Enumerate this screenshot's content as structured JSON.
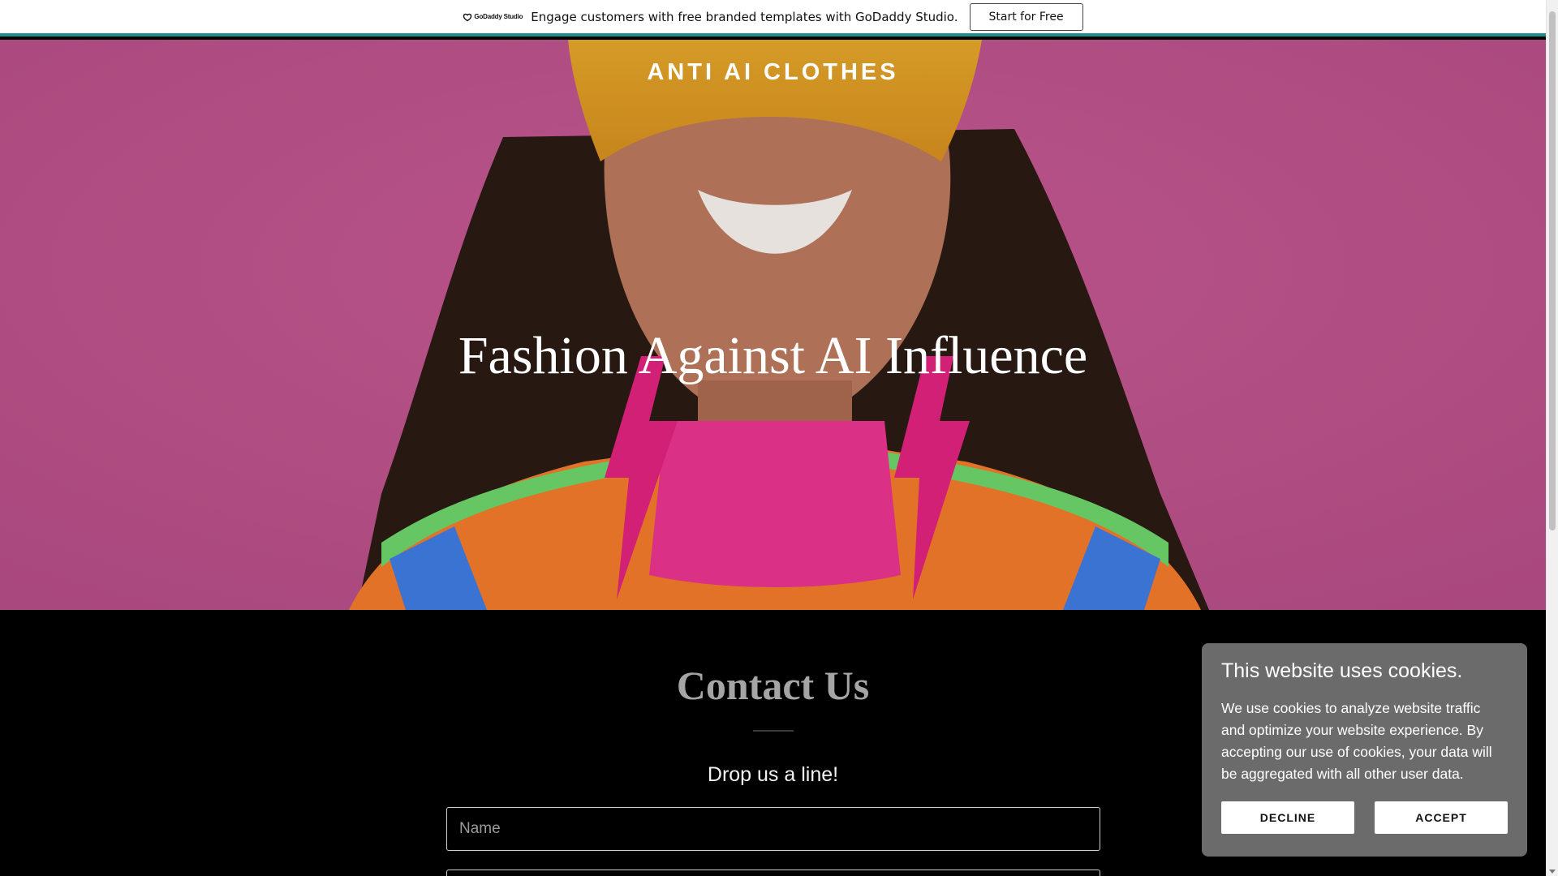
{
  "promo": {
    "logo_text": "GoDaddy Studio",
    "message": "Engage customers with free branded templates with GoDaddy Studio.",
    "cta_label": "Start for Free"
  },
  "hero": {
    "site_title": "ANTI AI CLOTHES",
    "tagline": "Fashion Against AI Influence"
  },
  "contact": {
    "title": "Contact Us",
    "subtitle": "Drop us a line!",
    "name_placeholder": "Name"
  },
  "cookie_banner": {
    "title": "This website uses cookies.",
    "body": "We use cookies to analyze website traffic and optimize your website experience. By accepting our use of cookies, your data will be aggregated with all other user data.",
    "decline_label": "DECLINE",
    "accept_label": "ACCEPT"
  },
  "colors": {
    "promo_accent": "#1a8e91",
    "hero_background": "#c0558e",
    "cookie_background": "#6b6b6b"
  }
}
